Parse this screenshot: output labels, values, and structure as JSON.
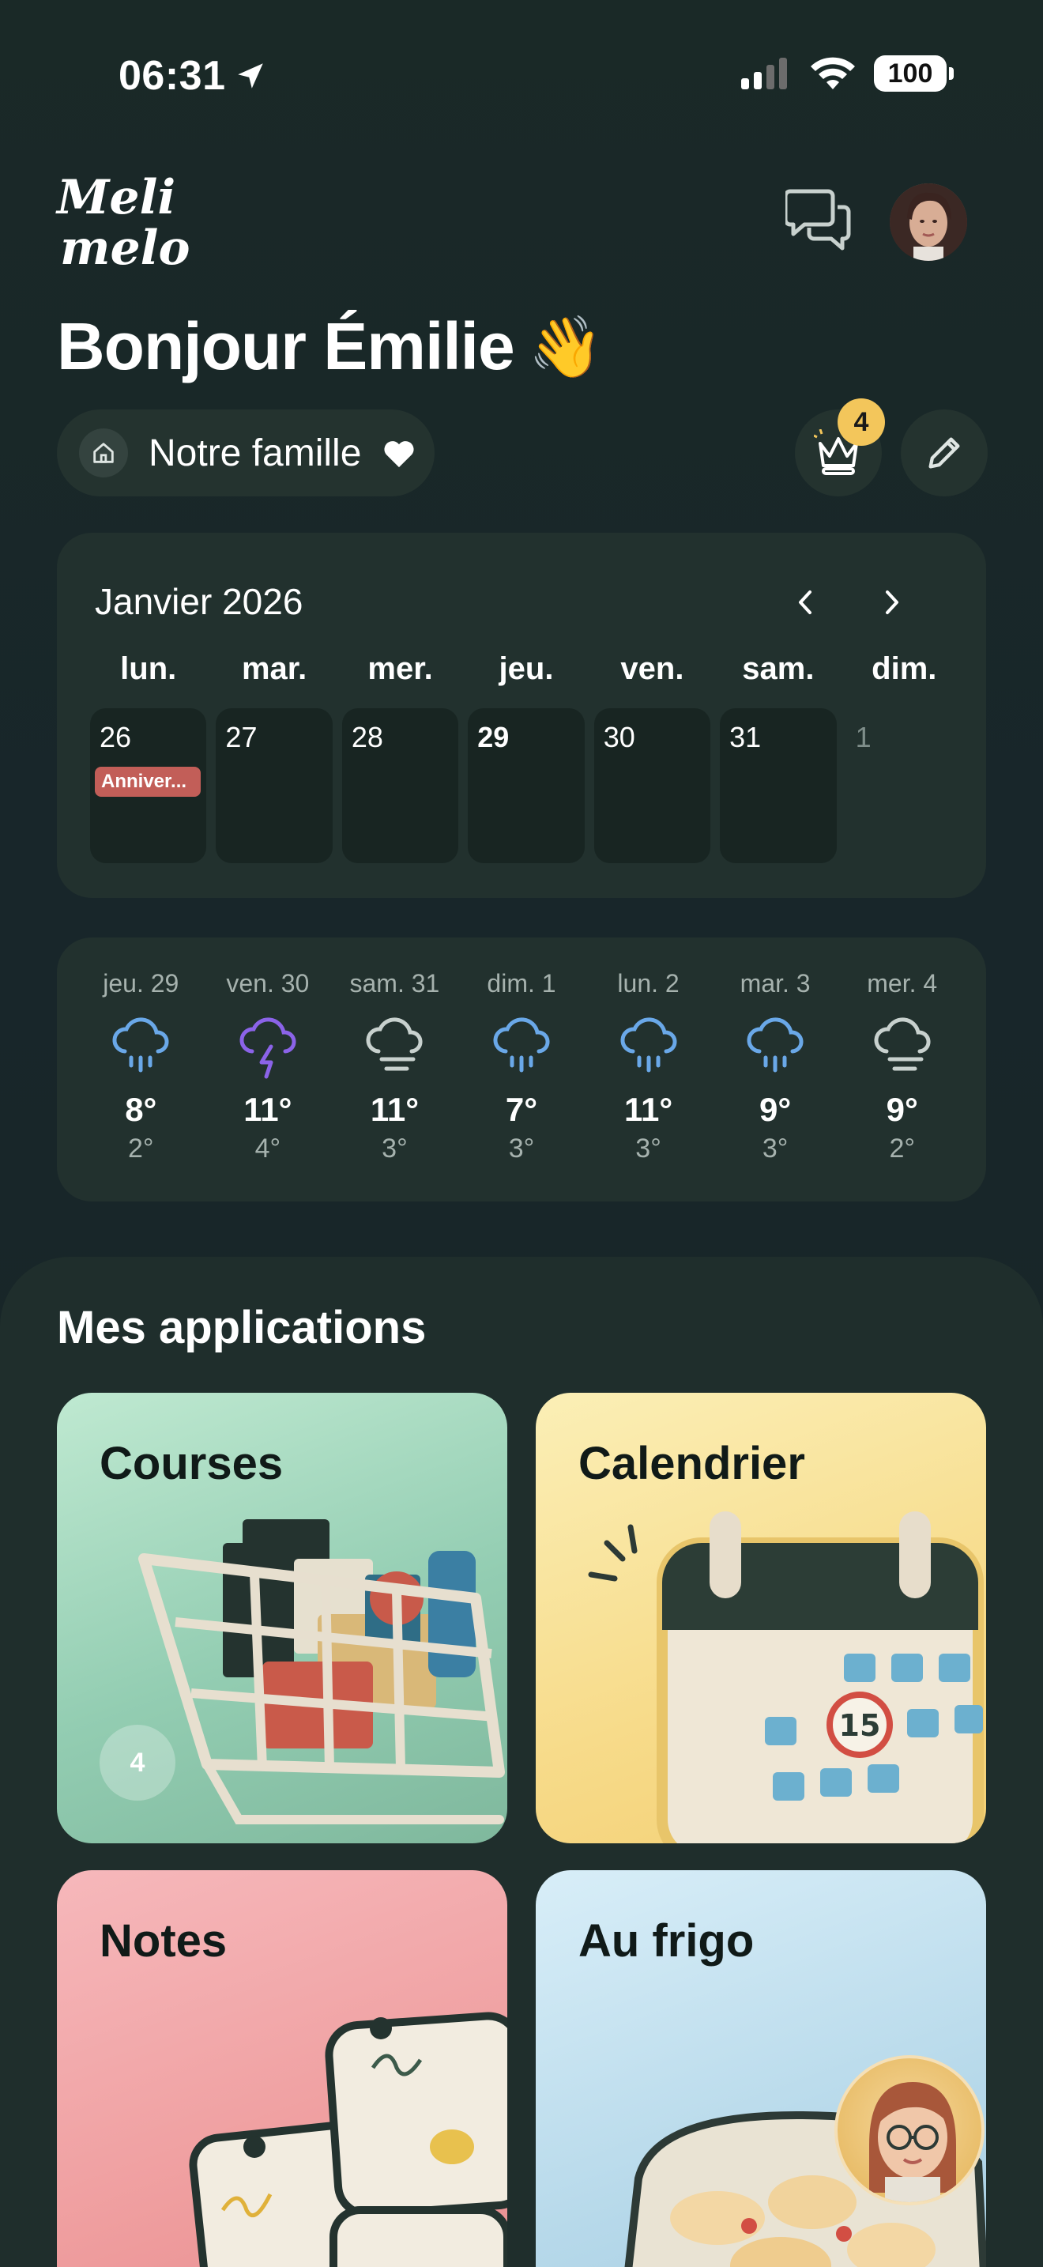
{
  "status_bar": {
    "time": "06:31",
    "battery": "100"
  },
  "header": {
    "logo_line1": "Meli",
    "logo_line2": "melo",
    "greeting": "Bonjour Émilie",
    "greeting_emoji": "👋"
  },
  "family": {
    "label": "Notre famille",
    "crown_count": "4"
  },
  "calendar": {
    "title": "Janvier 2026",
    "day_names": [
      "lun.",
      "mar.",
      "mer.",
      "jeu.",
      "ven.",
      "sam.",
      "dim."
    ],
    "days": [
      {
        "num": "26",
        "event": "Anniver..."
      },
      {
        "num": "27",
        "event": ""
      },
      {
        "num": "28",
        "event": ""
      },
      {
        "num": "29",
        "event": ""
      },
      {
        "num": "30",
        "event": ""
      },
      {
        "num": "31",
        "event": ""
      },
      {
        "num": "1",
        "event": ""
      }
    ],
    "today_index": 3
  },
  "weather": [
    {
      "day": "jeu. 29",
      "icon": "rain-icon",
      "high": "8°",
      "low": "2°"
    },
    {
      "day": "ven. 30",
      "icon": "storm-icon",
      "high": "11°",
      "low": "4°"
    },
    {
      "day": "sam. 31",
      "icon": "fog-icon",
      "high": "11°",
      "low": "3°"
    },
    {
      "day": "dim. 1",
      "icon": "rain-icon",
      "high": "7°",
      "low": "3°"
    },
    {
      "day": "lun. 2",
      "icon": "rain-icon",
      "high": "11°",
      "low": "3°"
    },
    {
      "day": "mar. 3",
      "icon": "rain-icon",
      "high": "9°",
      "low": "3°"
    },
    {
      "day": "mer. 4",
      "icon": "fog-icon",
      "high": "9°",
      "low": "2°"
    }
  ],
  "apps": {
    "title": "Mes applications",
    "courses": {
      "label": "Courses",
      "badge": "4"
    },
    "calendar": {
      "label": "Calendrier",
      "date_number": "15"
    },
    "notes": {
      "label": "Notes"
    },
    "frigo": {
      "label": "Au frigo"
    }
  },
  "colors": {
    "background": "#1a2927",
    "card": "#22312e",
    "accent_rain": "#6aa8e8",
    "accent_storm": "#8b63e8",
    "event": "#c25e58",
    "crown_badge": "#f3c65b"
  }
}
